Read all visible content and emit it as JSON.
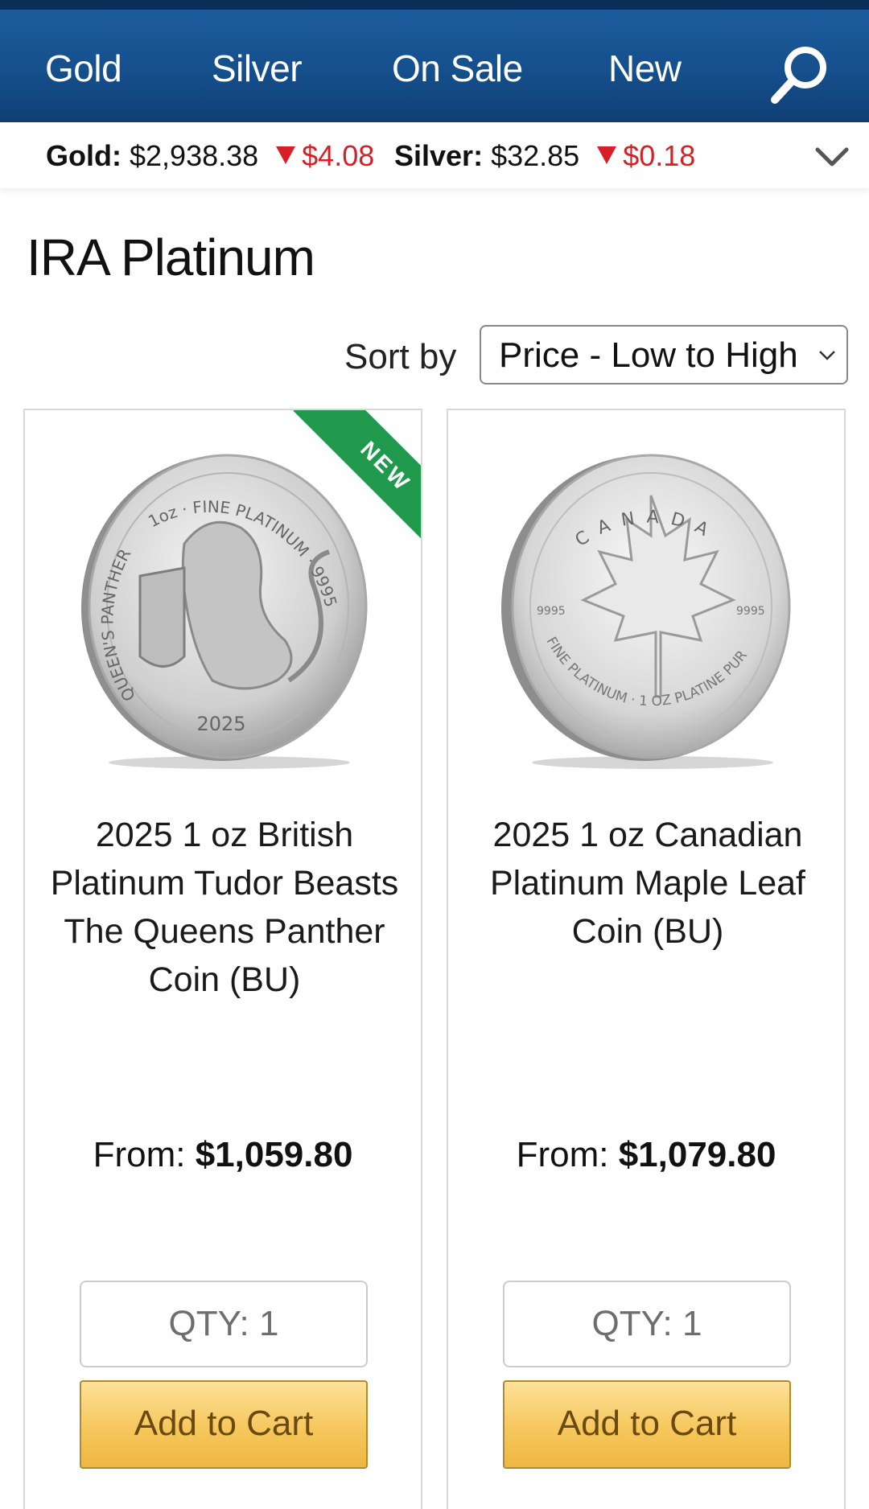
{
  "nav": {
    "items": [
      {
        "label": "Gold"
      },
      {
        "label": "Silver"
      },
      {
        "label": "On Sale"
      },
      {
        "label": "New"
      }
    ],
    "search_icon": "search-icon"
  },
  "spot_prices": {
    "gold": {
      "label": "Gold:",
      "price": "$2,938.38",
      "change": "$4.08",
      "direction": "down"
    },
    "silver": {
      "label": "Silver:",
      "price": "$32.85",
      "change": "$0.18",
      "direction": "down"
    },
    "expand_icon": "chevron-down-icon",
    "down_color": "#d61f26"
  },
  "page": {
    "title": "IRA Platinum"
  },
  "sort": {
    "label": "Sort by",
    "selected": "Price - Low to High"
  },
  "products": [
    {
      "name": "2025 1 oz British Platinum Tudor Beasts The Queens Panther Coin (BU)",
      "badge": "NEW",
      "price_prefix": "From:",
      "price": "$1,059.80",
      "qty_placeholder": "QTY: 1",
      "cart_label": "Add to Cart",
      "coin_text": {
        "top": "1oz · FINE PLATINUM · 9995",
        "left": "QUEEN'S PANTHER",
        "year": "2025"
      }
    },
    {
      "name": "2025 1 oz Canadian Platinum Maple Leaf Coin (BU)",
      "badge": "",
      "price_prefix": "From:",
      "price": "$1,079.80",
      "qty_placeholder": "QTY: 1",
      "cart_label": "Add to Cart",
      "coin_text": {
        "top": "CANADA",
        "left": "9995",
        "right": "9995",
        "bottom": "FINE PLATINUM · 1 OZ PLATINE PUR"
      }
    }
  ],
  "colors": {
    "nav_bg": "#154f8c",
    "badge_green": "#1f9a4c",
    "cart_gold": "#f6c75d"
  }
}
